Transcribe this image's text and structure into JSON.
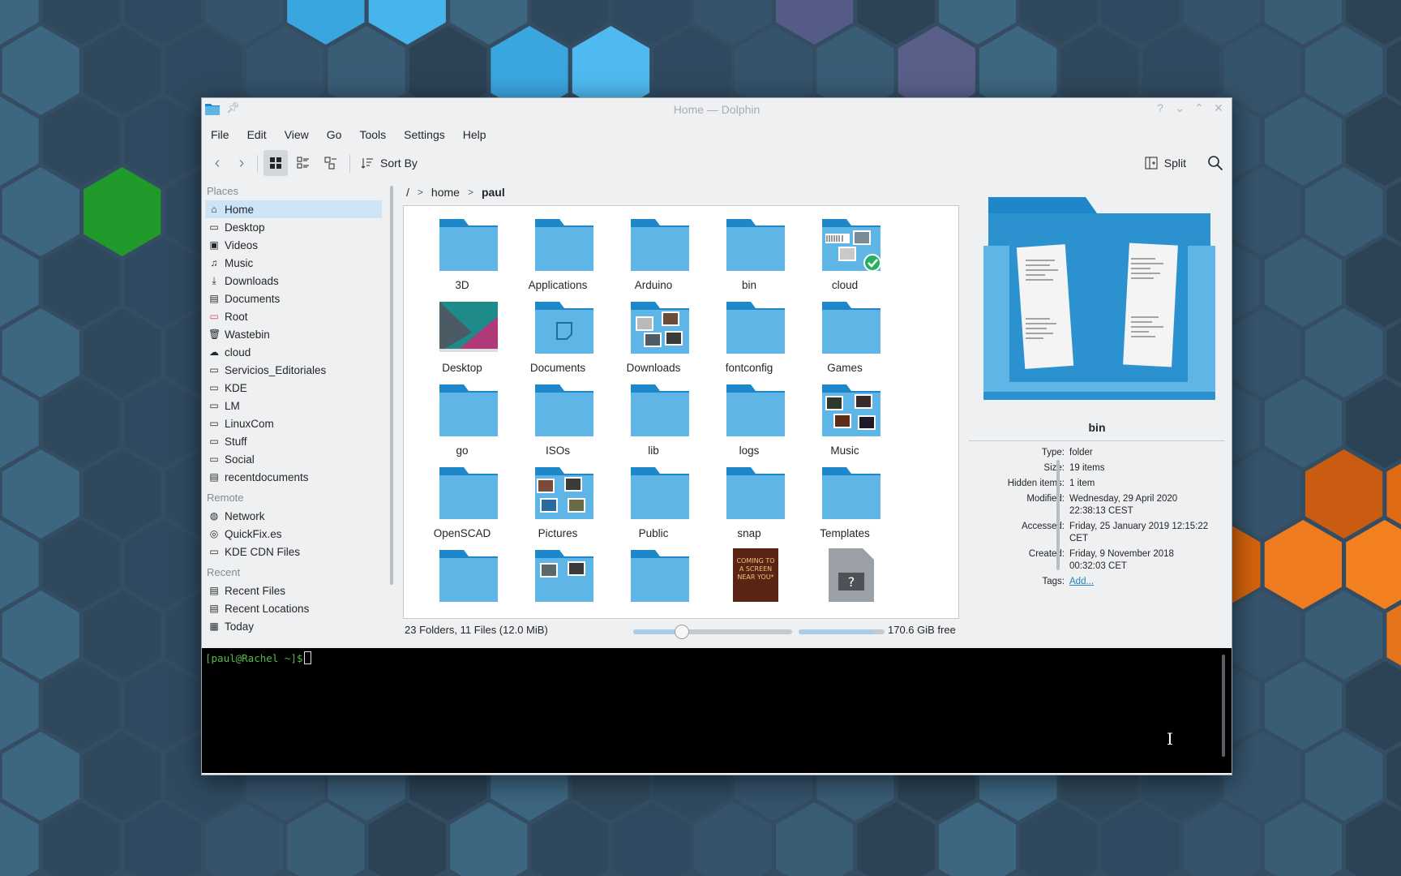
{
  "window": {
    "title": "Home — Dolphin",
    "buttons": [
      "?",
      "⌄",
      "⌃",
      "✕"
    ]
  },
  "menubar": [
    "File",
    "Edit",
    "View",
    "Go",
    "Tools",
    "Settings",
    "Help"
  ],
  "toolbar": {
    "sort_by": "Sort By",
    "split": "Split"
  },
  "sidebar": {
    "places_header": "Places",
    "places": [
      "Home",
      "Desktop",
      "Videos",
      "Music",
      "Downloads",
      "Documents",
      "Root",
      "Wastebin",
      "cloud",
      "Servicios_Editoriales",
      "KDE",
      "LM",
      "LinuxCom",
      "Stuff",
      "Social",
      "recentdocuments"
    ],
    "remote_header": "Remote",
    "remote": [
      "Network",
      "QuickFix.es",
      "KDE CDN Files"
    ],
    "recent_header": "Recent",
    "recent": [
      "Recent Files",
      "Recent Locations",
      "Today"
    ]
  },
  "breadcrumb": {
    "root": "/",
    "parts": [
      "home",
      "paul"
    ]
  },
  "files": [
    "3D",
    "Applications",
    "Arduino",
    "bin",
    "cloud",
    "Desktop",
    "Documents",
    "Downloads",
    "fontconfig",
    "Games",
    "go",
    "ISOs",
    "lib",
    "logs",
    "Music",
    "OpenSCAD",
    "Pictures",
    "Public",
    "snap",
    "Templates"
  ],
  "partial_row": [
    "folder",
    "folder-pictures",
    "folder",
    "poster",
    "file"
  ],
  "poster_text": "COMING TO A SCREEN NEAR YOU",
  "status": {
    "summary": "23 Folders, 11 Files (12.0 MiB)",
    "free": "170.6 GiB free",
    "zoom_fraction": 0.3,
    "used_fraction": 0.88
  },
  "info": {
    "name": "bin",
    "props": [
      {
        "k": "Type:",
        "v": "folder"
      },
      {
        "k": "Size:",
        "v": "19 items"
      },
      {
        "k": "Hidden items:",
        "v": "1 item"
      },
      {
        "k": "Modified:",
        "v": "Wednesday, 29 April 2020 22:38:13 CEST"
      },
      {
        "k": "Accessed:",
        "v": "Friday, 25 January 2019 12:15:22 CET"
      },
      {
        "k": "Created:",
        "v": "Friday, 9 November 2018 00:32:03 CET"
      },
      {
        "k": "Tags:",
        "v": "Add..."
      }
    ]
  },
  "terminal": {
    "prompt": "[paul@Rachel ~]$"
  },
  "colors": {
    "folder_light": "#5fb6e6",
    "folder_dark": "#1d87c9",
    "selection": "#cde3f6",
    "terminal_green": "#56b84a"
  }
}
